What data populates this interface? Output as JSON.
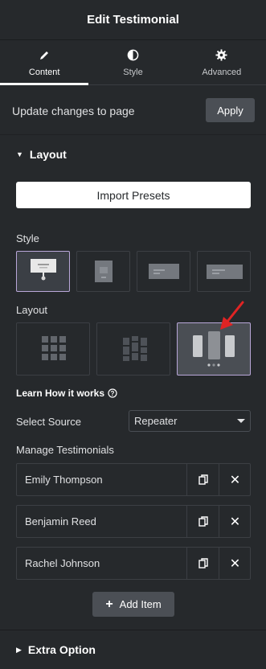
{
  "header": {
    "title": "Edit Testimonial"
  },
  "tabs": [
    {
      "label": "Content",
      "icon": "pencil-icon",
      "active": true
    },
    {
      "label": "Style",
      "icon": "half-circle-icon",
      "active": false
    },
    {
      "label": "Advanced",
      "icon": "gear-icon",
      "active": false
    }
  ],
  "update": {
    "text": "Update changes to page",
    "apply_label": "Apply"
  },
  "layout_section": {
    "title": "Layout",
    "import_label": "Import Presets",
    "style_label": "Style",
    "style_options": [
      "style-1",
      "style-2",
      "style-3",
      "style-4"
    ],
    "style_selected": 0,
    "layout_label": "Layout",
    "layout_options": [
      "grid",
      "masonry",
      "carousel"
    ],
    "layout_selected": 2,
    "learn_label": "Learn How it works",
    "source_label": "Select Source",
    "source_value": "Repeater",
    "manage_label": "Manage Testimonials",
    "items": [
      {
        "name": "Emily Thompson"
      },
      {
        "name": "Benjamin Reed"
      },
      {
        "name": "Rachel Johnson"
      }
    ],
    "add_label": "Add Item"
  },
  "extra_section": {
    "title": "Extra Option"
  },
  "colors": {
    "accent_border": "#b9a7d9",
    "arrow": "#e02424",
    "bg": "#26292c"
  }
}
